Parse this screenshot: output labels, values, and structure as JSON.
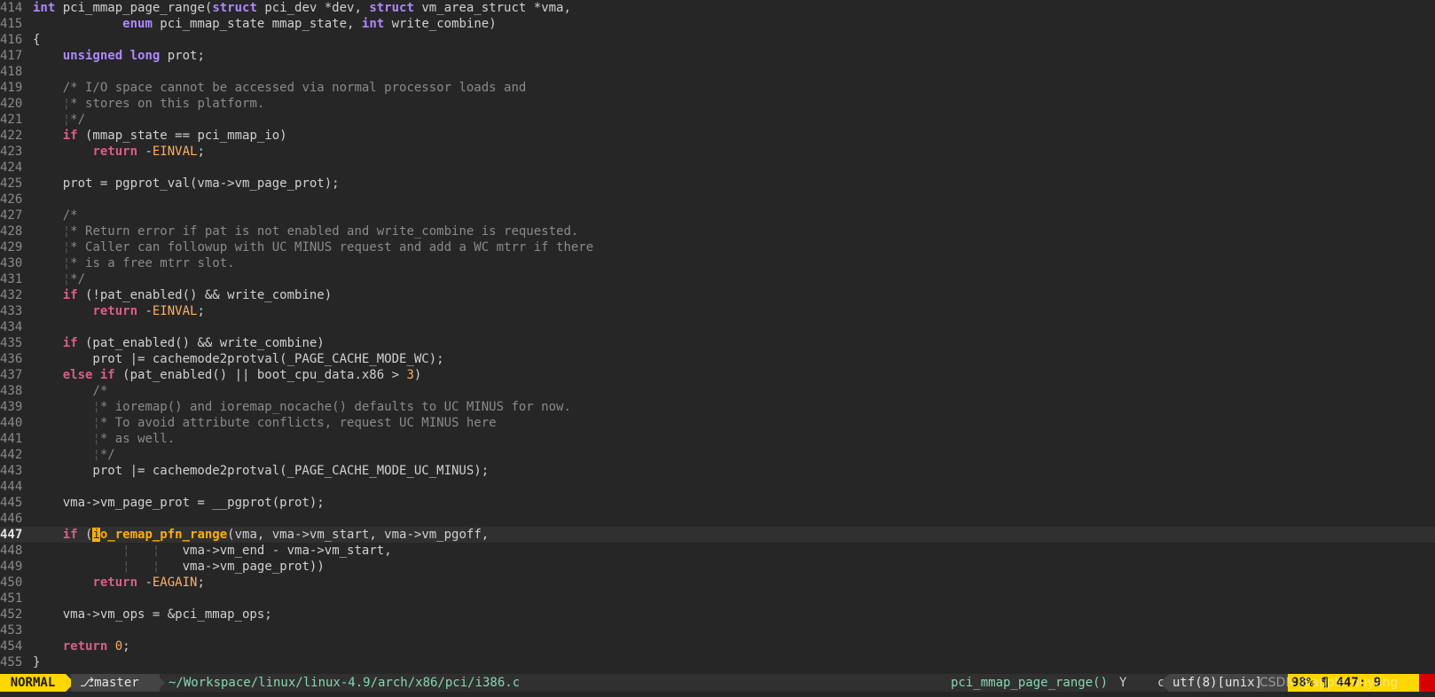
{
  "lines": [
    {
      "n": "414",
      "segs": [
        {
          "t": "int",
          "c": "ty"
        },
        {
          "t": " pci_mmap_page_range("
        },
        {
          "t": "struct",
          "c": "ty"
        },
        {
          "t": " pci_dev *dev, "
        },
        {
          "t": "struct",
          "c": "ty"
        },
        {
          "t": " vm_area_struct *vma,"
        }
      ]
    },
    {
      "n": "415",
      "segs": [
        {
          "t": "            "
        },
        {
          "t": "enum",
          "c": "ty"
        },
        {
          "t": " pci_mmap_state mmap_state, "
        },
        {
          "t": "int",
          "c": "ty"
        },
        {
          "t": " write_combine)"
        }
      ]
    },
    {
      "n": "416",
      "segs": [
        {
          "t": "{"
        }
      ]
    },
    {
      "n": "417",
      "segs": [
        {
          "t": "    "
        },
        {
          "t": "unsigned",
          "c": "ty"
        },
        {
          "t": " "
        },
        {
          "t": "long",
          "c": "ty"
        },
        {
          "t": " prot;"
        }
      ]
    },
    {
      "n": "418",
      "segs": []
    },
    {
      "n": "419",
      "segs": [
        {
          "t": "    "
        },
        {
          "t": "/* I/O space cannot be accessed via normal processor loads and",
          "c": "cm"
        }
      ]
    },
    {
      "n": "420",
      "segs": [
        {
          "t": "    "
        },
        {
          "t": "¦",
          "c": "guide"
        },
        {
          "t": "* stores on this platform.",
          "c": "cm"
        }
      ]
    },
    {
      "n": "421",
      "segs": [
        {
          "t": "    "
        },
        {
          "t": "¦",
          "c": "guide"
        },
        {
          "t": "*/",
          "c": "cm"
        }
      ]
    },
    {
      "n": "422",
      "segs": [
        {
          "t": "    "
        },
        {
          "t": "if",
          "c": "kw"
        },
        {
          "t": " (mmap_state == pci_mmap_io)"
        }
      ]
    },
    {
      "n": "423",
      "segs": [
        {
          "t": "        "
        },
        {
          "t": "return",
          "c": "kw"
        },
        {
          "t": " -"
        },
        {
          "t": "EINVAL",
          "c": "cst"
        },
        {
          "t": ";"
        }
      ]
    },
    {
      "n": "424",
      "segs": []
    },
    {
      "n": "425",
      "segs": [
        {
          "t": "    prot = pgprot_val(vma->vm_page_prot);"
        }
      ]
    },
    {
      "n": "426",
      "segs": []
    },
    {
      "n": "427",
      "segs": [
        {
          "t": "    "
        },
        {
          "t": "/*",
          "c": "cm"
        }
      ]
    },
    {
      "n": "428",
      "segs": [
        {
          "t": "    "
        },
        {
          "t": "¦",
          "c": "guide"
        },
        {
          "t": "* Return error if pat is not enabled and write_combine is requested.",
          "c": "cm"
        }
      ]
    },
    {
      "n": "429",
      "segs": [
        {
          "t": "    "
        },
        {
          "t": "¦",
          "c": "guide"
        },
        {
          "t": "* Caller can followup with UC MINUS request and add a WC mtrr if there",
          "c": "cm"
        }
      ]
    },
    {
      "n": "430",
      "segs": [
        {
          "t": "    "
        },
        {
          "t": "¦",
          "c": "guide"
        },
        {
          "t": "* is a free mtrr slot.",
          "c": "cm"
        }
      ]
    },
    {
      "n": "431",
      "segs": [
        {
          "t": "    "
        },
        {
          "t": "¦",
          "c": "guide"
        },
        {
          "t": "*/",
          "c": "cm"
        }
      ]
    },
    {
      "n": "432",
      "segs": [
        {
          "t": "    "
        },
        {
          "t": "if",
          "c": "kw"
        },
        {
          "t": " (!pat_enabled() && write_combine)"
        }
      ]
    },
    {
      "n": "433",
      "segs": [
        {
          "t": "        "
        },
        {
          "t": "return",
          "c": "kw"
        },
        {
          "t": " -"
        },
        {
          "t": "EINVAL",
          "c": "cst"
        },
        {
          "t": ";"
        }
      ]
    },
    {
      "n": "434",
      "segs": []
    },
    {
      "n": "435",
      "segs": [
        {
          "t": "    "
        },
        {
          "t": "if",
          "c": "kw"
        },
        {
          "t": " (pat_enabled() && write_combine)"
        }
      ]
    },
    {
      "n": "436",
      "segs": [
        {
          "t": "        prot |= cachemode2protval(_PAGE_CACHE_MODE_WC);"
        }
      ]
    },
    {
      "n": "437",
      "segs": [
        {
          "t": "    "
        },
        {
          "t": "else",
          "c": "kw"
        },
        {
          "t": " "
        },
        {
          "t": "if",
          "c": "kw"
        },
        {
          "t": " (pat_enabled() || boot_cpu_data.x86 > "
        },
        {
          "t": "3",
          "c": "num"
        },
        {
          "t": ")"
        }
      ]
    },
    {
      "n": "438",
      "segs": [
        {
          "t": "        "
        },
        {
          "t": "/*",
          "c": "cm"
        }
      ]
    },
    {
      "n": "439",
      "segs": [
        {
          "t": "        "
        },
        {
          "t": "¦",
          "c": "guide"
        },
        {
          "t": "* ioremap() and ioremap_nocache() defaults to UC MINUS for now.",
          "c": "cm"
        }
      ]
    },
    {
      "n": "440",
      "segs": [
        {
          "t": "        "
        },
        {
          "t": "¦",
          "c": "guide"
        },
        {
          "t": "* To avoid attribute conflicts, request UC MINUS here",
          "c": "cm"
        }
      ]
    },
    {
      "n": "441",
      "segs": [
        {
          "t": "        "
        },
        {
          "t": "¦",
          "c": "guide"
        },
        {
          "t": "* as well.",
          "c": "cm"
        }
      ]
    },
    {
      "n": "442",
      "segs": [
        {
          "t": "        "
        },
        {
          "t": "¦",
          "c": "guide"
        },
        {
          "t": "*/",
          "c": "cm"
        }
      ]
    },
    {
      "n": "443",
      "segs": [
        {
          "t": "        prot |= cachemode2protval(_PAGE_CACHE_MODE_UC_MINUS);"
        }
      ]
    },
    {
      "n": "444",
      "segs": []
    },
    {
      "n": "445",
      "segs": [
        {
          "t": "    vma->vm_page_prot = __pgprot(prot);"
        }
      ]
    },
    {
      "n": "446",
      "segs": []
    },
    {
      "n": "447",
      "cur": true,
      "segs": [
        {
          "t": "    "
        },
        {
          "t": "if",
          "c": "kw"
        },
        {
          "t": " ("
        },
        {
          "t": "i",
          "c": "cursor"
        },
        {
          "t": "o_remap_pfn_range",
          "c": "fnhl"
        },
        {
          "t": "(vma, vma->vm_start, vma->vm_pgoff,"
        }
      ]
    },
    {
      "n": "448",
      "segs": [
        {
          "t": "            "
        },
        {
          "t": "¦",
          "c": "guide"
        },
        {
          "t": "   "
        },
        {
          "t": "¦",
          "c": "guide"
        },
        {
          "t": "   vma->vm_end - vma->vm_start,"
        }
      ]
    },
    {
      "n": "449",
      "segs": [
        {
          "t": "            "
        },
        {
          "t": "¦",
          "c": "guide"
        },
        {
          "t": "   "
        },
        {
          "t": "¦",
          "c": "guide"
        },
        {
          "t": "   vma->vm_page_prot))"
        }
      ]
    },
    {
      "n": "450",
      "segs": [
        {
          "t": "        "
        },
        {
          "t": "return",
          "c": "kw"
        },
        {
          "t": " -"
        },
        {
          "t": "EAGAIN",
          "c": "cst"
        },
        {
          "t": ";"
        }
      ]
    },
    {
      "n": "451",
      "segs": []
    },
    {
      "n": "452",
      "segs": [
        {
          "t": "    vma->vm_ops = &pci_mmap_ops;"
        }
      ]
    },
    {
      "n": "453",
      "segs": []
    },
    {
      "n": "454",
      "segs": [
        {
          "t": "    "
        },
        {
          "t": "return",
          "c": "kw"
        },
        {
          "t": " "
        },
        {
          "t": "0",
          "c": "num"
        },
        {
          "t": ";"
        }
      ]
    },
    {
      "n": "455",
      "segs": [
        {
          "t": "}"
        }
      ]
    }
  ],
  "status": {
    "mode": "NORMAL",
    "branch": "⎇master",
    "filepath": "~/Workspace/linux/linux-4.9/arch/x86/pci/i386.c",
    "function": "pci_mmap_page_range()",
    "function_sep": "Ү",
    "filetype": "c",
    "encoding": "utf(8)[unix]",
    "position": "98% ¶ 447:  9"
  },
  "watermark": "CSDN @apple_ouyang",
  "colors": {
    "background": "#262626",
    "keyword": "#d75f87",
    "type": "#af87ff",
    "comment": "#8a8a8a",
    "number": "#ffaf5f",
    "mode_bg": "#ffd700",
    "path": "#87d7af"
  }
}
